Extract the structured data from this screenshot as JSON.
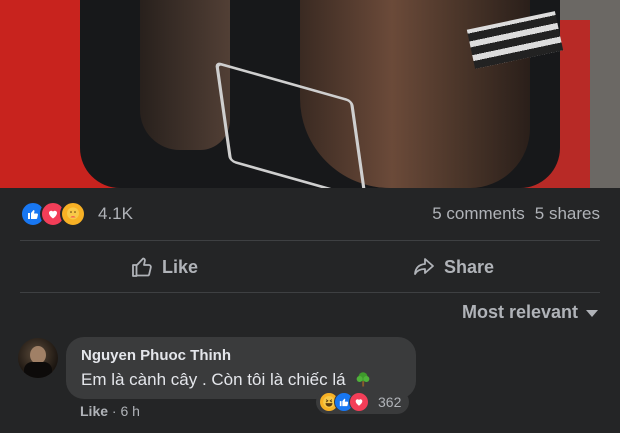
{
  "post": {
    "reaction_icons": [
      "like-icon",
      "love-icon",
      "care-icon"
    ],
    "reaction_count": "4.1K",
    "comments": "5 comments",
    "shares": "5 shares"
  },
  "actions": {
    "like_label": "Like",
    "share_label": "Share"
  },
  "comments_section": {
    "sort_label": "Most relevant"
  },
  "comment": {
    "author": "Nguyen Phuoc Thinh",
    "text": "Em là cành cây . Còn tôi là chiếc lá",
    "reaction_icons": [
      "haha-icon",
      "like-icon",
      "love-icon"
    ],
    "reaction_count": "362",
    "like_label": "Like",
    "separator": " · ",
    "time": "6 h"
  },
  "colors": {
    "background": "#242526",
    "bubble": "#3a3b3c",
    "like_blue": "#1877f2",
    "love_red": "#f33e58",
    "secondary_text": "#b0b3b8"
  }
}
